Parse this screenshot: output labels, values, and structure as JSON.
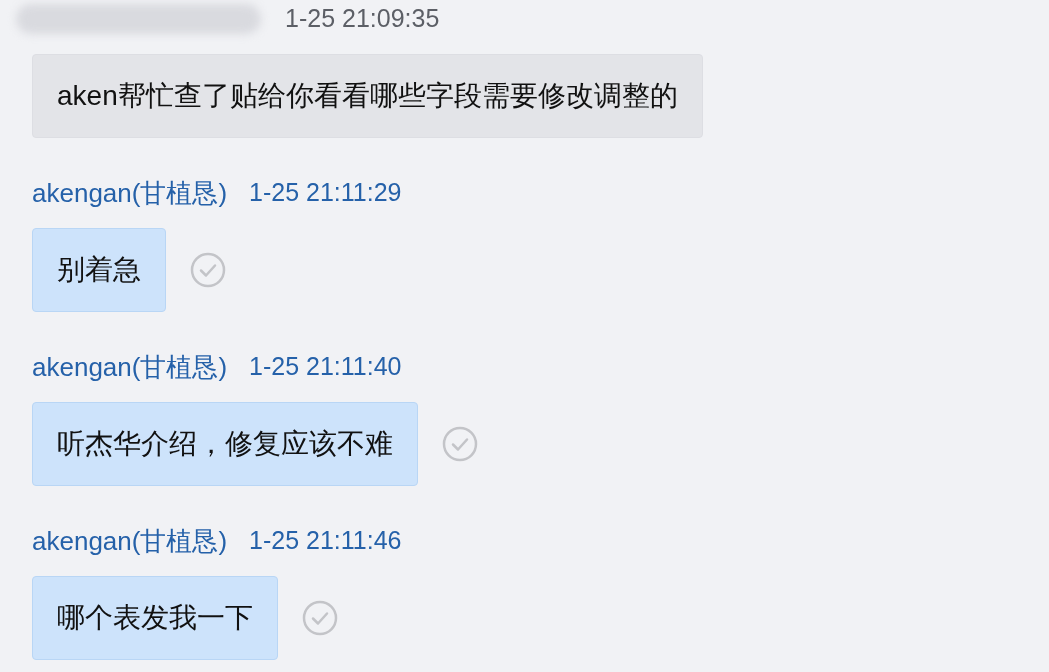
{
  "messages": [
    {
      "kind": "incoming",
      "sender_hidden": true,
      "time": "1-25 21:09:35",
      "text": "aken帮忙查了贴给你看看哪些字段需要修改调整的"
    },
    {
      "kind": "outgoing",
      "sender": "akengan(甘植恳)",
      "time": "1-25 21:11:29",
      "text": "别着急"
    },
    {
      "kind": "outgoing",
      "sender": "akengan(甘植恳)",
      "time": "1-25 21:11:40",
      "text": "听杰华介绍，修复应该不难"
    },
    {
      "kind": "outgoing",
      "sender": "akengan(甘植恳)",
      "time": "1-25 21:11:46",
      "text": "哪个表发我一下"
    }
  ]
}
